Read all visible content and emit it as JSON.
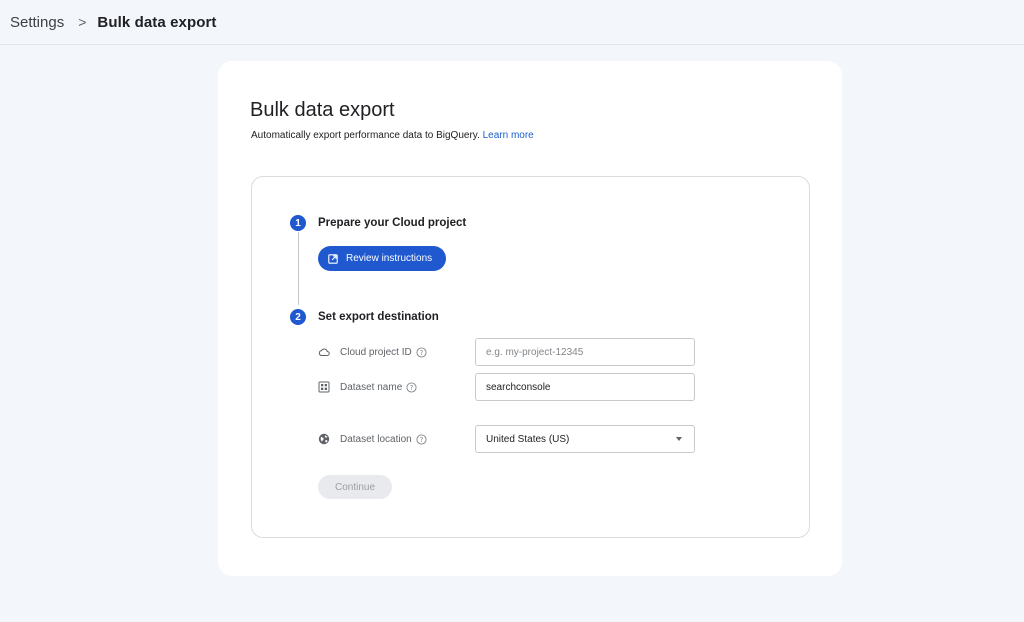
{
  "breadcrumb": {
    "root": "Settings",
    "separator": ">",
    "current": "Bulk data export"
  },
  "card": {
    "title": "Bulk data export",
    "subtitle": "Automatically export performance data to BigQuery.",
    "learn_more": "Learn more"
  },
  "steps": [
    {
      "number": "1",
      "title": "Prepare your Cloud project",
      "button_label": "Review instructions"
    },
    {
      "number": "2",
      "title": "Set export destination"
    }
  ],
  "fields": {
    "project_id": {
      "label": "Cloud project ID",
      "placeholder": "e.g. my-project-12345",
      "value": "",
      "icon": "cloud-icon"
    },
    "dataset_name": {
      "label": "Dataset name",
      "value": "searchconsole",
      "icon": "grid-icon"
    },
    "dataset_location": {
      "label": "Dataset location",
      "value": "United States (US)",
      "icon": "globe-icon"
    }
  },
  "continue_label": "Continue",
  "colors": {
    "accent": "#1f58cf",
    "link": "#1a5fd0",
    "page_bg": "#f3f6fb",
    "disabled_bg": "#e8eaed"
  }
}
